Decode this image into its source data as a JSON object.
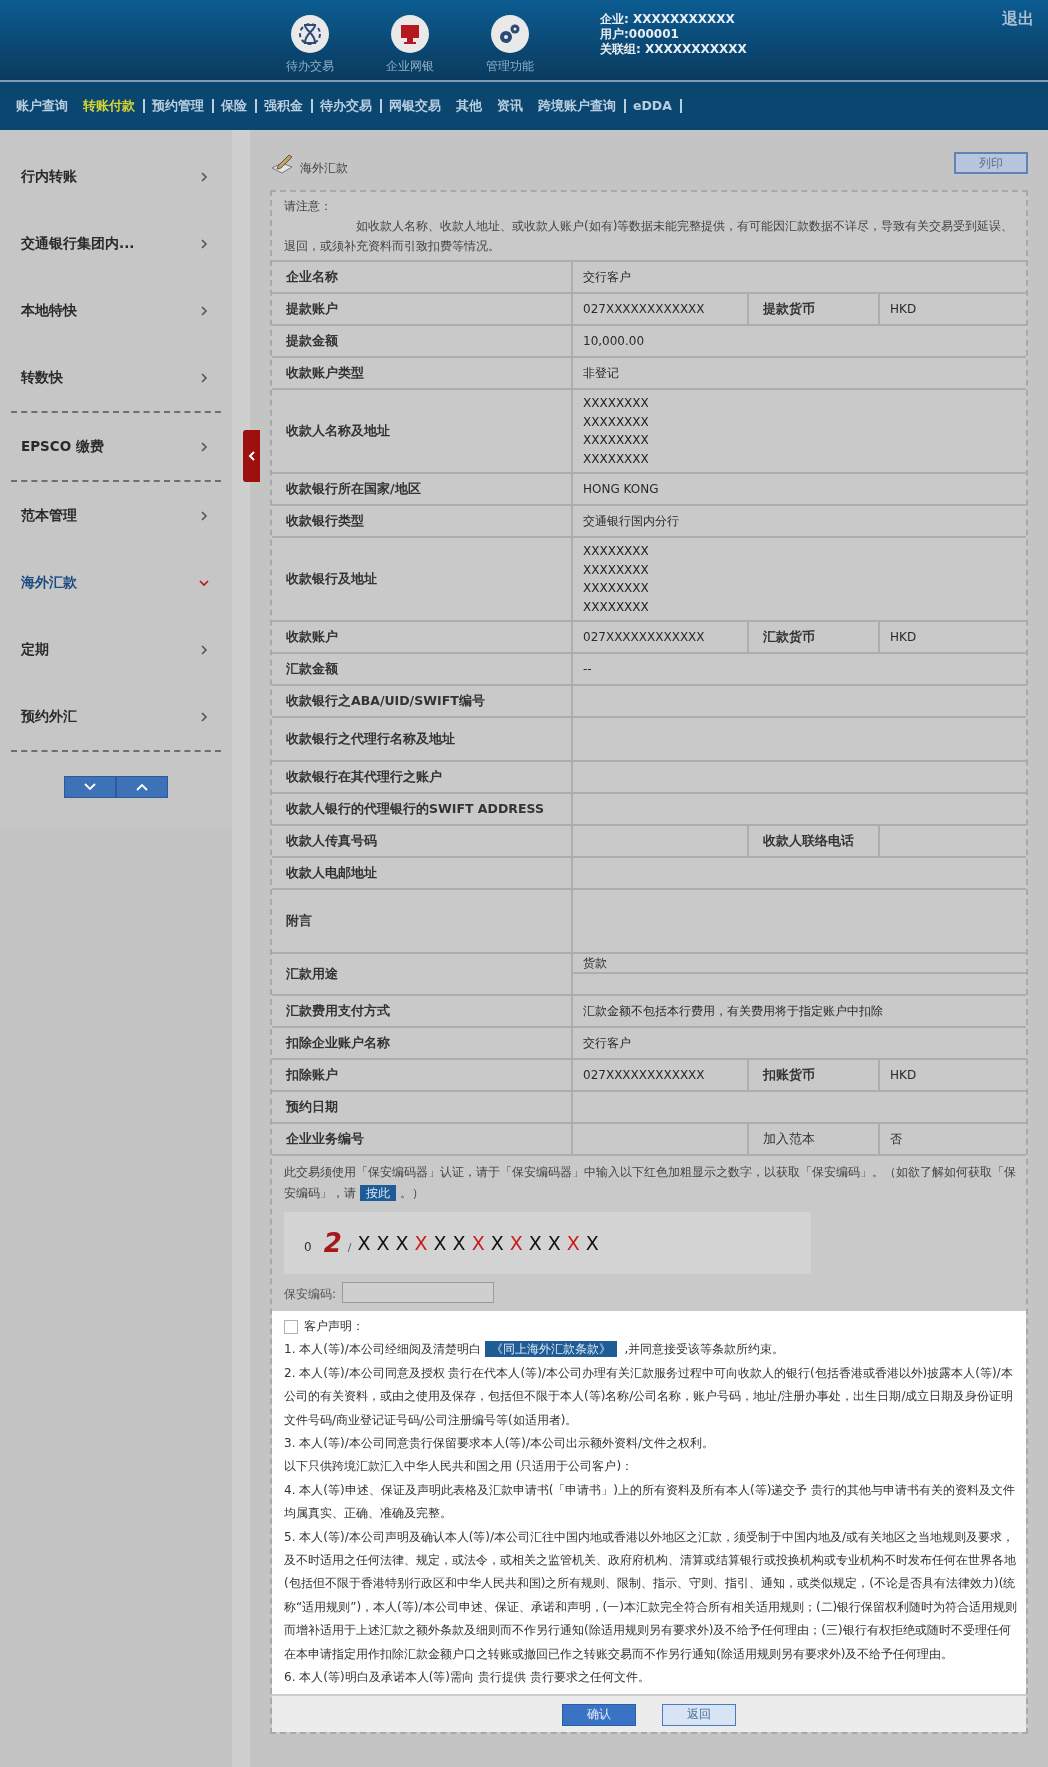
{
  "header": {
    "shortcuts": [
      {
        "kind": "hourglass",
        "label": "待办交易"
      },
      {
        "kind": "monitor",
        "label": "企业网银"
      },
      {
        "kind": "gears",
        "label": "管理功能"
      }
    ],
    "info": [
      "企业: XXXXXXXXXXX",
      "用户:000001",
      "关联组: XXXXXXXXXXX"
    ],
    "logout": "退出"
  },
  "nav": [
    {
      "label": "账户查询",
      "selected": false,
      "separator": false
    },
    {
      "label": "转账付款",
      "selected": true,
      "separator": true
    },
    {
      "label": "预约管理",
      "selected": false,
      "separator": true
    },
    {
      "label": "保险",
      "selected": false,
      "separator": true
    },
    {
      "label": "强积金",
      "selected": false,
      "separator": true
    },
    {
      "label": "待办交易",
      "selected": false,
      "separator": true
    },
    {
      "label": "网银交易",
      "selected": false,
      "separator": false
    },
    {
      "label": "其他",
      "selected": false,
      "separator": false
    },
    {
      "label": "资讯",
      "selected": false,
      "separator": false
    },
    {
      "label": "跨境账户查询",
      "selected": false,
      "separator": true
    },
    {
      "label": "eDDA",
      "selected": false,
      "separator": true
    }
  ],
  "sidebar": {
    "groups": [
      {
        "items": [
          {
            "label": "行内转账",
            "selected": false
          },
          {
            "label": "交通银行集团内...",
            "selected": false
          },
          {
            "label": "本地特快",
            "selected": false
          },
          {
            "label": "转数快",
            "selected": false
          }
        ]
      },
      {
        "items": [
          {
            "label": "EPSCO 缴费",
            "selected": false
          }
        ]
      },
      {
        "items": [
          {
            "label": "范本管理",
            "selected": false
          },
          {
            "label": "海外汇款",
            "selected": true
          },
          {
            "label": "定期",
            "selected": false
          },
          {
            "label": "预约外汇",
            "selected": false
          }
        ]
      }
    ]
  },
  "page": {
    "title": "海外汇款",
    "print_button": "列印"
  },
  "notice": {
    "heading": "请注意：",
    "text": "如收款人名称、收款人地址、或收款人账户(如有)等数据未能完整提供，有可能因汇款数据不详尽，导致有关交易受到延误、退回，或须补充资料而引致扣费等情况。"
  },
  "rows": [
    {
      "kind": "single",
      "label": "企业名称",
      "value": "交行客户"
    },
    {
      "kind": "split",
      "label": "提款账户",
      "value": "027XXXXXXXXXXXX",
      "label2": "提款货币",
      "value2": "HKD"
    },
    {
      "kind": "single",
      "label": "提款金额",
      "value": "10,000.00"
    },
    {
      "kind": "single",
      "label": "收款账户类型",
      "value": "非登记"
    },
    {
      "kind": "lines",
      "label": "收款人名称及地址",
      "lines": [
        "XXXXXXXX",
        "XXXXXXXX",
        "XXXXXXXX",
        "XXXXXXXX"
      ]
    },
    {
      "kind": "single",
      "label": "收款银行所在国家/地区",
      "value": "HONG KONG"
    },
    {
      "kind": "single",
      "label": "收款银行类型",
      "value": "交通银行国内分行"
    },
    {
      "kind": "lines",
      "label": "收款银行及地址",
      "lines": [
        "XXXXXXXX",
        "XXXXXXXX",
        "XXXXXXXX",
        "XXXXXXXX"
      ]
    },
    {
      "kind": "split",
      "label": "收款账户",
      "value": "027XXXXXXXXXXXX",
      "label2": "汇款货币",
      "value2": "HKD"
    },
    {
      "kind": "single",
      "label": "汇款金额",
      "value": "--"
    },
    {
      "kind": "single",
      "label": "收款银行之ABA/UID/SWIFT编号"
    },
    {
      "kind": "tall",
      "label": "收款银行之代理行名称及地址"
    },
    {
      "kind": "single",
      "label": "收款银行在其代理行之账户"
    },
    {
      "kind": "single",
      "label": "收款人银行的代理银行的SWIFT ADDRESS"
    },
    {
      "kind": "split",
      "label": "收款人传真号码",
      "label2": "收款人联络电话"
    },
    {
      "kind": "single",
      "label": "收款人电邮地址"
    },
    {
      "kind": "memo",
      "label": "附言"
    },
    {
      "kind": "stacked",
      "label": "汇款用途",
      "value": "货款"
    },
    {
      "kind": "single",
      "label": "汇款费用支付方式",
      "value": "汇款金额不包括本行费用，有关费用将于指定账户中扣除"
    },
    {
      "kind": "single",
      "label": "扣除企业账户名称",
      "value": "交行客户"
    },
    {
      "kind": "split",
      "label": "扣除账户",
      "value": "027XXXXXXXXXXXX",
      "label2": "扣账货币",
      "value2": "HKD"
    },
    {
      "kind": "single",
      "label": "预约日期"
    },
    {
      "kind": "split",
      "label": "企业业务编号",
      "label2": "加入范本",
      "value2": "否",
      "label2_plain": true
    }
  ],
  "security": {
    "text": "此交易须使用「保安编码器」认证，请于「保安编码器」中输入以下红色加粗显示之数字，以获取「保安编码」。（如欲了解如何获取「保安编码」，请",
    "link": "按此",
    "after": "。）",
    "lead": "0",
    "digit": "2",
    "slash": "/",
    "chars": [
      {
        "char": "X",
        "highlight": false
      },
      {
        "char": "X",
        "highlight": false
      },
      {
        "char": "X",
        "highlight": false
      },
      {
        "char": "X",
        "highlight": true
      },
      {
        "char": "X",
        "highlight": false
      },
      {
        "char": "X",
        "highlight": false
      },
      {
        "char": "X",
        "highlight": true
      },
      {
        "char": "X",
        "highlight": false
      },
      {
        "char": "X",
        "highlight": true
      },
      {
        "char": "X",
        "highlight": false
      },
      {
        "char": "X",
        "highlight": false
      },
      {
        "char": "X",
        "highlight": true
      },
      {
        "char": "X",
        "highlight": false
      }
    ],
    "field_label": "保安编码:"
  },
  "declaration": {
    "checked": false,
    "heading": "客户声明：",
    "items": [
      {
        "text": "1. 本人(等)/本公司经细阅及清楚明白",
        "link": "《同上海外汇款条款》",
        "after": " ,并同意接受该等条款所约束。"
      },
      {
        "text": "2. 本人(等)/本公司同意及授权 贵行在代本人(等)/本公司办理有关汇款服务过程中可向收款人的银行(包括香港或香港以外)披露本人(等)/本公司的有关资料，或由之使用及保存，包括但不限于本人(等)名称/公司名称，账户号码，地址/注册办事处，出生日期/成立日期及身份证明文件号码/商业登记证号码/公司注册编号等(如适用者)。"
      },
      {
        "text": "3. 本人(等)/本公司同意贵行保留要求本人(等)/本公司出示额外资料/文件之权利。"
      },
      {
        "text": "以下只供跨境汇款汇入中华人民共和国之用 (只适用于公司客户)："
      },
      {
        "text": "4. 本人(等)申述、保证及声明此表格及汇款申请书(「申请书」)上的所有资料及所有本人(等)递交予 贵行的其他与申请书有关的资料及文件均属真实、正确、准确及完整。"
      },
      {
        "text": "5. 本人(等)/本公司声明及确认本人(等)/本公司汇往中国内地或香港以外地区之汇款，须受制于中国内地及/或有关地区之当地规则及要求，及不时适用之任何法律、规定，或法令，或相关之监管机关、政府府机构、清算或结算银行或投换机构或专业机构不时发布任何在世界各地(包括但不限于香港特别行政区和中华人民共和国)之所有规则、限制、指示、守则、指引、通知，或类似规定，(不论是否具有法律效力)(统称“适用规则”)，本人(等)/本公司申述、保证、承诺和声明，(一)本汇款完全符合所有相关适用规则；(二)银行保留权利随时为符合适用规则而增补适用于上述汇款之额外条款及细则而不作另行通知(除适用规则另有要求外)及不给予任何理由；(三)银行有权拒绝或随时不受理任何在本申请指定用作扣除汇款金额户口之转账或撤回已作之转账交易而不作另行通知(除适用规则另有要求外)及不给予任何理由。"
      },
      {
        "text": "6. 本人(等)明白及承诺本人(等)需向 贵行提供 贵行要求之任何文件。"
      }
    ]
  },
  "buttons": [
    {
      "kind": "primary",
      "label": "确认"
    },
    {
      "kind": "secondary",
      "label": "返回"
    }
  ]
}
